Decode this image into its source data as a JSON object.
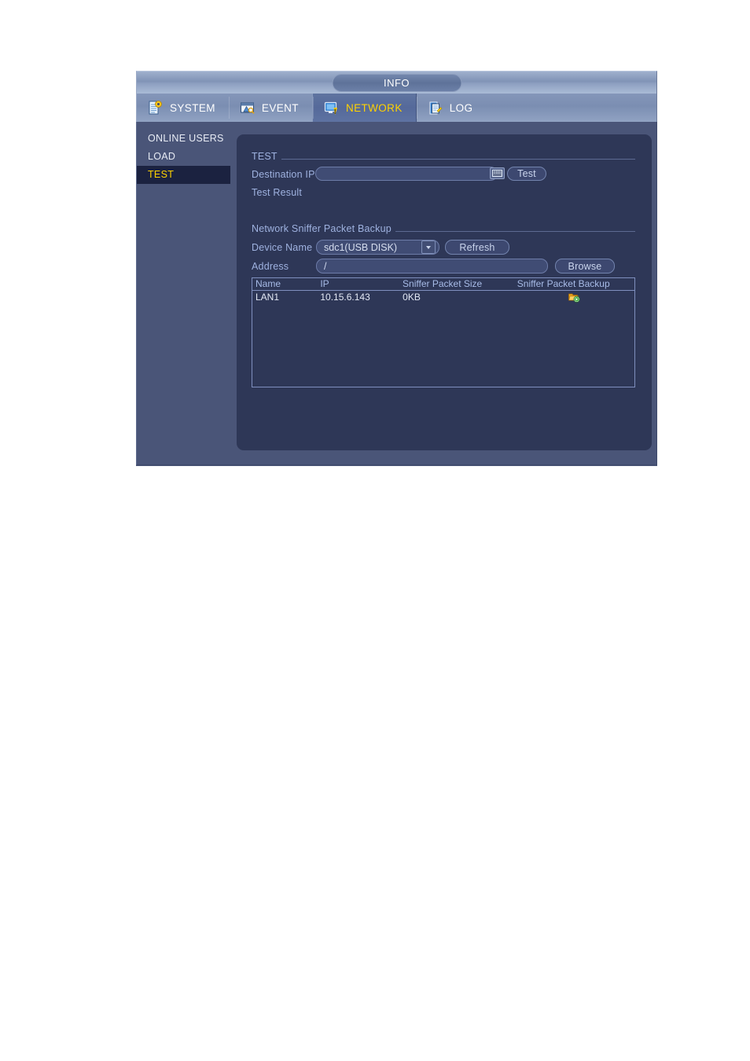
{
  "window": {
    "title": "INFO"
  },
  "tabs": [
    {
      "label": "SYSTEM",
      "icon": "document-gear-icon",
      "active": false
    },
    {
      "label": "EVENT",
      "icon": "event-warning-icon",
      "active": false
    },
    {
      "label": "NETWORK",
      "icon": "network-monitor-icon",
      "active": true
    },
    {
      "label": "LOG",
      "icon": "log-clipboard-icon",
      "active": false
    }
  ],
  "sidebar": {
    "items": [
      {
        "label": "ONLINE USERS",
        "selected": false
      },
      {
        "label": "LOAD",
        "selected": false
      },
      {
        "label": "TEST",
        "selected": true
      }
    ]
  },
  "test_section": {
    "title": "TEST",
    "destination_ip_label": "Destination IP",
    "destination_ip_value": "",
    "keyboard_icon": "keyboard-icon",
    "test_button": "Test",
    "test_result_label": "Test Result",
    "test_result_value": ""
  },
  "sniffer_section": {
    "title": "Network Sniffer Packet Backup",
    "device_name_label": "Device Name",
    "device_name_value": "sdc1(USB DISK)",
    "refresh_button": "Refresh",
    "address_label": "Address",
    "address_value": "/",
    "browse_button": "Browse",
    "table": {
      "columns": [
        "Name",
        "IP",
        "Sniffer Packet Size",
        "Sniffer Packet Backup"
      ],
      "rows": [
        {
          "name": "LAN1",
          "ip": "10.15.6.143",
          "size": "0KB",
          "backup_icon": "sniffer-backup-start-icon"
        }
      ]
    }
  },
  "colors": {
    "window_bg": "#4a5578",
    "panel_bg": "#2e3757",
    "accent_yellow": "#ffd200",
    "label_blue": "#9fb2e0",
    "selected_item_bg": "#1b2240"
  }
}
